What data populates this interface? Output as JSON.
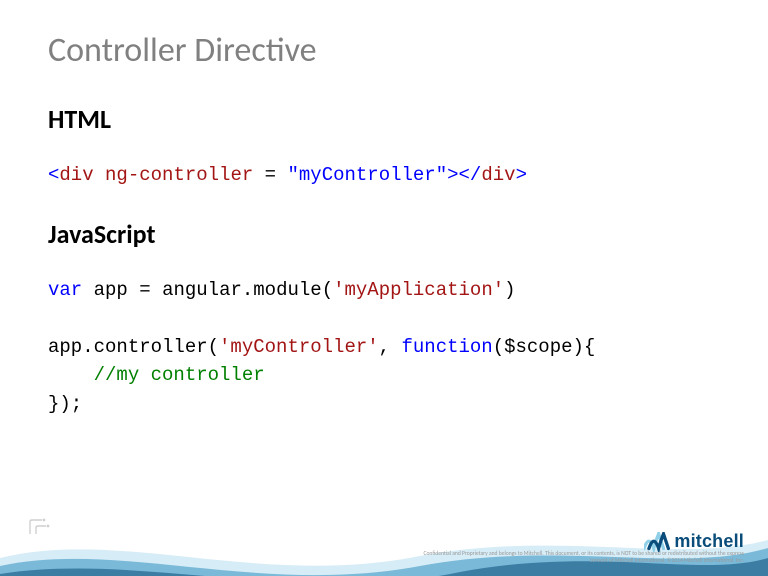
{
  "title": "Controller Directive",
  "sections": {
    "html": {
      "heading": "HTML",
      "code": {
        "tag_open": "<",
        "tag_name": "div",
        "attr_name": "ng-controller",
        "eq": " = ",
        "attr_value": "\"myController\"",
        "tag_close_open": ">",
        "close_tag_open": "</",
        "close_tag_name": "div",
        "close_tag_close": ">"
      }
    },
    "js": {
      "heading": "JavaScript",
      "code": {
        "kw_var": "var",
        "sp1": " ",
        "app_name": "app",
        "sp2": " ",
        "op_eq": "=",
        "sp3": " ",
        "ang": "angular.module(",
        "mod_str": "'myApplication'",
        "close_paren1": ")",
        "line2a": "app.controller(",
        "ctrl_str": "'myController'",
        "comma_sp": ", ",
        "kw_fn": "function",
        "fn_args": "($scope){",
        "indent": "    ",
        "comment": "//my controller",
        "close": "});"
      }
    }
  },
  "brand": {
    "name": "mitchell",
    "colors": {
      "deep": "#0a4d7a",
      "mid": "#2f8fbf",
      "light": "#8fd0e8"
    }
  },
  "disclaimer": "Confidential and Proprietary and belongs to Mitchell. This document, or its contents, is NOT to be shared or redistributed without the express consent of Mitchell International. ©2014 Mitchell International, Inc."
}
